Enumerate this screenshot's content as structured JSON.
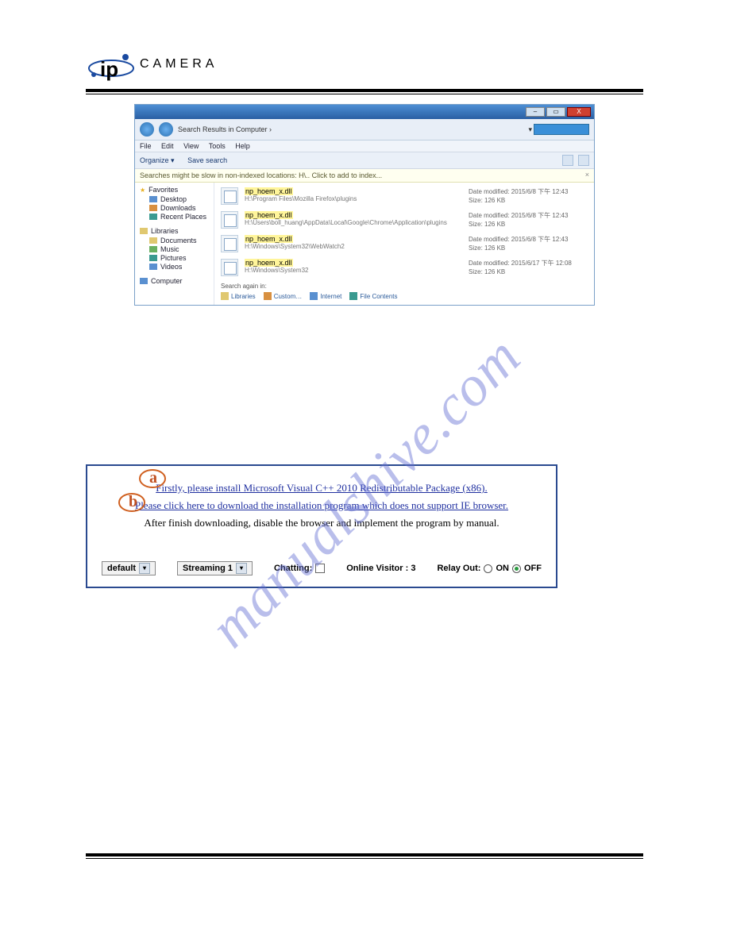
{
  "logo": {
    "camera_text": "CAMERA"
  },
  "explorer": {
    "title_buttons": {
      "min": "–",
      "max": "▭",
      "close": "X"
    },
    "breadcrumb": "Search Results in Computer  ›",
    "search_hint": "np_hoem_x.dll",
    "menu": [
      "File",
      "Edit",
      "View",
      "Tools",
      "Help"
    ],
    "toolbar": {
      "organize": "Organize ▾",
      "save": "Save search"
    },
    "infobar": "Searches might be slow in non-indexed locations: H\\.. Click to add to index...",
    "sidebar": {
      "favorites": {
        "head": "Favorites",
        "items": [
          "Desktop",
          "Downloads",
          "Recent Places"
        ]
      },
      "libraries": {
        "head": "Libraries",
        "items": [
          "Documents",
          "Music",
          "Pictures",
          "Videos"
        ]
      },
      "computer": {
        "head": "Computer"
      }
    },
    "results": [
      {
        "name": "np_hoem_x.dll",
        "path": "H:\\Program Files\\Mozilla Firefox\\plugins",
        "modified": "Date modified: 2015/6/8 下午 12:43",
        "size": "Size: 126 KB"
      },
      {
        "name": "np_hoem_x.dll",
        "path": "H:\\Users\\boll_huang\\AppData\\Local\\Google\\Chrome\\Application\\plugins",
        "modified": "Date modified: 2015/6/8 下午 12:43",
        "size": "Size: 126 KB"
      },
      {
        "name": "np_hoem_x.dll",
        "path": "H:\\Windows\\System32\\WebWatch2",
        "modified": "Date modified: 2015/6/8 下午 12:43",
        "size": "Size: 126 KB"
      },
      {
        "name": "np_hoem_x.dll",
        "path": "H:\\Windows\\System32",
        "modified": "Date modified: 2015/6/17 下午 12:08",
        "size": "Size: 126 KB"
      }
    ],
    "search_again": {
      "label": "Search again in:",
      "targets": [
        "Libraries",
        "Custom…",
        "Internet",
        "File Contents"
      ]
    }
  },
  "watermark": "manualshive.com",
  "panel": {
    "line_a": "Firstly, please install Microsoft Visual C++ 2010 Redistributable Package (x86).",
    "line_b": "Please click here to download the installation program which does not support IE browser.",
    "line_c": "After finish downloading, disable the browser and implement the program by manual.",
    "badge_a": "a",
    "badge_b": "b",
    "controls": {
      "preset": "default",
      "stream": "Streaming 1",
      "chatting_label": "Chatting:",
      "visitor_label": "Online Visitor : 3",
      "relay_label": "Relay Out:",
      "on": "ON",
      "off": "OFF",
      "relay_state": "off"
    }
  }
}
